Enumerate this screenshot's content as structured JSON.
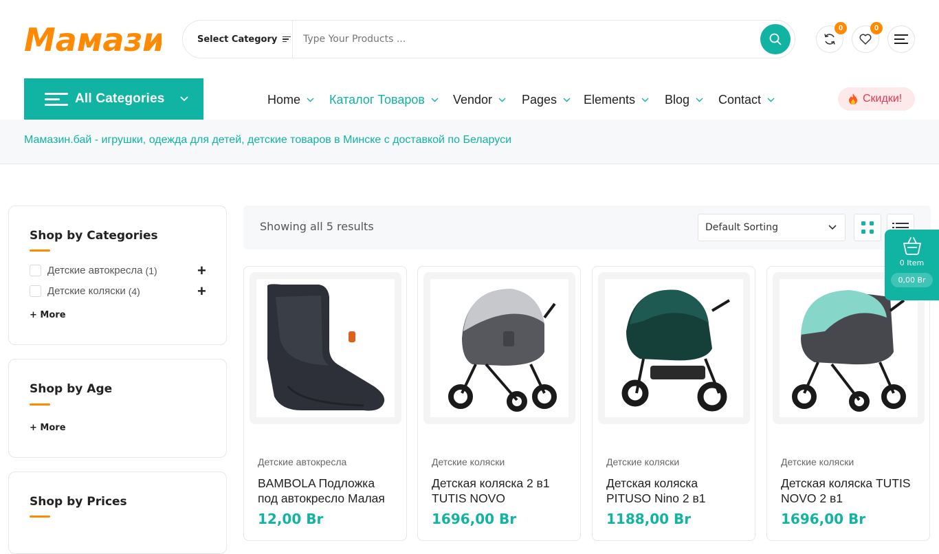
{
  "header": {
    "logo_text": "Мамазин",
    "search": {
      "category_label": "Select Category",
      "placeholder": "Type Your Products ..."
    },
    "compare_count": "0",
    "wishlist_count": "0"
  },
  "nav": {
    "all_categories": "All Categories",
    "items": [
      {
        "label": "Home"
      },
      {
        "label": "Каталог Товаров"
      },
      {
        "label": "Vendor"
      },
      {
        "label": "Pages"
      },
      {
        "label": "Elements"
      },
      {
        "label": "Blog"
      },
      {
        "label": "Contact"
      }
    ],
    "sale_label": "Скидки!"
  },
  "breadcrumb": {
    "text": "Мамазин.бай - игрушки, одежда для детей, детские товаров в Минске с доставкой по Беларуси"
  },
  "sidebar": {
    "categories": {
      "title": "Shop by Categories",
      "items": [
        {
          "label": "Детские автокресла",
          "count": "(1)"
        },
        {
          "label": "Детские коляски",
          "count": "(4)"
        }
      ],
      "more": "+ More"
    },
    "age": {
      "title": "Shop by Age",
      "more": "+ More"
    },
    "prices": {
      "title": "Shop by Prices"
    }
  },
  "toolbar": {
    "showing": "Showing all 5 results",
    "sort_selected": "Default Sorting"
  },
  "cart": {
    "items": "0 Item",
    "total": "0,00 Br"
  },
  "products": [
    {
      "category": "Детские автокресла",
      "name": "BAMBOLA Подложка под автокресло Малая",
      "price": "12,00 Br"
    },
    {
      "category": "Детские коляски",
      "name": "Детская коляска 2 в1 TUTIS NOVO",
      "price": "1696,00 Br"
    },
    {
      "category": "Детские коляски",
      "name": "Детская коляска PITUSO Nino 2 в1",
      "price": "1188,00 Br"
    },
    {
      "category": "Детские коляски",
      "name": "Детская коляска TUTIS NOVO 2 в1",
      "price": "1696,00 Br"
    }
  ],
  "colors": {
    "accent": "#11b3a3",
    "orange": "#ff8a00",
    "sale": "#e8384f"
  }
}
